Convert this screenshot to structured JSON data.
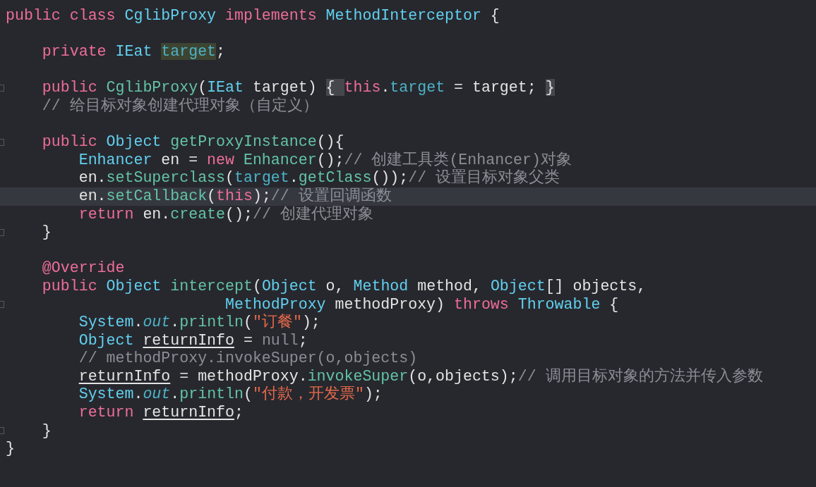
{
  "editor": {
    "lines": [
      {
        "fold_marker": false,
        "current": false,
        "tokens": [
          {
            "text": "public class ",
            "kind": "keyword"
          },
          {
            "text": "CglibProxy ",
            "kind": "type"
          },
          {
            "text": "implements ",
            "kind": "keyword"
          },
          {
            "text": "MethodInterceptor ",
            "kind": "type"
          },
          {
            "text": "{",
            "kind": "plain"
          }
        ]
      },
      {
        "fold_marker": false,
        "current": false
      },
      {
        "fold_marker": false,
        "current": false,
        "tokens": [
          {
            "text": "    private ",
            "kind": "keyword"
          },
          {
            "text": "IEat ",
            "kind": "type"
          },
          {
            "text": "target",
            "kind": "field_highlight"
          },
          {
            "text": ";",
            "kind": "plain"
          }
        ]
      },
      {
        "fold_marker": false,
        "current": false
      },
      {
        "fold_marker": true,
        "current": false,
        "tokens": [
          {
            "text": "    public ",
            "kind": "keyword"
          },
          {
            "text": "CglibProxy",
            "kind": "method"
          },
          {
            "text": "(",
            "kind": "plain"
          },
          {
            "text": "IEat ",
            "kind": "type"
          },
          {
            "text": "target)",
            "kind": "plain"
          },
          {
            "text": " { ",
            "kind": "folded"
          },
          {
            "text": "this",
            "kind": "keyword"
          },
          {
            "text": ".",
            "kind": "plain"
          },
          {
            "text": "target",
            "kind": "field"
          },
          {
            "text": " = target;",
            "kind": "plain"
          },
          {
            "text": " }",
            "kind": "folded"
          }
        ]
      },
      {
        "fold_marker": false,
        "current": false,
        "tokens": [
          {
            "text": "    // 给目标对象创建代理对象（自定义）",
            "kind": "comment"
          }
        ]
      },
      {
        "fold_marker": false,
        "current": false
      },
      {
        "fold_marker": true,
        "current": false,
        "tokens": [
          {
            "text": "    public ",
            "kind": "keyword"
          },
          {
            "text": "Object ",
            "kind": "type"
          },
          {
            "text": "getProxyInstance",
            "kind": "method"
          },
          {
            "text": "(){",
            "kind": "plain"
          }
        ]
      },
      {
        "fold_marker": false,
        "current": false,
        "tokens": [
          {
            "text": "        Enhancer ",
            "kind": "type"
          },
          {
            "text": "en = ",
            "kind": "plain"
          },
          {
            "text": "new ",
            "kind": "keyword"
          },
          {
            "text": "Enhancer",
            "kind": "method"
          },
          {
            "text": "();",
            "kind": "plain"
          },
          {
            "text": "// 创建工具类(Enhancer)对象",
            "kind": "comment"
          }
        ]
      },
      {
        "fold_marker": false,
        "current": false,
        "tokens": [
          {
            "text": "        en.",
            "kind": "plain"
          },
          {
            "text": "setSuperclass",
            "kind": "method"
          },
          {
            "text": "(",
            "kind": "plain"
          },
          {
            "text": "target",
            "kind": "field"
          },
          {
            "text": ".",
            "kind": "plain"
          },
          {
            "text": "getClass",
            "kind": "method"
          },
          {
            "text": "());",
            "kind": "plain"
          },
          {
            "text": "// 设置目标对象父类",
            "kind": "comment"
          }
        ]
      },
      {
        "fold_marker": false,
        "current": true,
        "tokens": [
          {
            "text": "        en.",
            "kind": "plain"
          },
          {
            "text": "setCallback",
            "kind": "method"
          },
          {
            "text": "(",
            "kind": "plain"
          },
          {
            "text": "this",
            "kind": "keyword"
          },
          {
            "text": ");",
            "kind": "plain"
          },
          {
            "text": "// 设置回调函数",
            "kind": "comment"
          }
        ]
      },
      {
        "fold_marker": false,
        "current": false,
        "tokens": [
          {
            "text": "        return ",
            "kind": "keyword"
          },
          {
            "text": "en.",
            "kind": "plain"
          },
          {
            "text": "create",
            "kind": "method"
          },
          {
            "text": "();",
            "kind": "plain"
          },
          {
            "text": "// 创建代理对象",
            "kind": "comment"
          }
        ]
      },
      {
        "fold_marker": true,
        "current": false,
        "tokens": [
          {
            "text": "    }",
            "kind": "plain"
          }
        ]
      },
      {
        "fold_marker": false,
        "current": false
      },
      {
        "fold_marker": false,
        "current": false,
        "tokens": [
          {
            "text": "    @Override",
            "kind": "keyword"
          }
        ]
      },
      {
        "fold_marker": false,
        "current": false,
        "tokens": [
          {
            "text": "    public ",
            "kind": "keyword"
          },
          {
            "text": "Object ",
            "kind": "type"
          },
          {
            "text": "intercept",
            "kind": "method"
          },
          {
            "text": "(",
            "kind": "plain"
          },
          {
            "text": "Object ",
            "kind": "type"
          },
          {
            "text": "o, ",
            "kind": "plain"
          },
          {
            "text": "Method ",
            "kind": "type"
          },
          {
            "text": "method, ",
            "kind": "plain"
          },
          {
            "text": "Object",
            "kind": "type"
          },
          {
            "text": "[] objects,",
            "kind": "plain"
          }
        ]
      },
      {
        "fold_marker": true,
        "current": false,
        "tokens": [
          {
            "text": "                        MethodProxy ",
            "kind": "type"
          },
          {
            "text": "methodProxy) ",
            "kind": "plain"
          },
          {
            "text": "throws ",
            "kind": "keyword"
          },
          {
            "text": "Throwable ",
            "kind": "type"
          },
          {
            "text": "{",
            "kind": "plain"
          }
        ]
      },
      {
        "fold_marker": false,
        "current": false,
        "tokens": [
          {
            "text": "        System",
            "kind": "type"
          },
          {
            "text": ".",
            "kind": "plain"
          },
          {
            "text": "out",
            "kind": "static_field"
          },
          {
            "text": ".",
            "kind": "plain"
          },
          {
            "text": "println",
            "kind": "method"
          },
          {
            "text": "(",
            "kind": "plain"
          },
          {
            "text": "\"订餐\"",
            "kind": "string"
          },
          {
            "text": ");",
            "kind": "plain"
          }
        ]
      },
      {
        "fold_marker": false,
        "current": false,
        "tokens": [
          {
            "text": "        Object ",
            "kind": "type"
          },
          {
            "text": "returnInfo",
            "kind": "reassigned"
          },
          {
            "text": " = ",
            "kind": "plain"
          },
          {
            "text": "null",
            "kind": "literal"
          },
          {
            "text": ";",
            "kind": "plain"
          }
        ]
      },
      {
        "fold_marker": false,
        "current": false,
        "tokens": [
          {
            "text": "        // methodProxy.invokeSuper(o,objects)",
            "kind": "comment"
          }
        ]
      },
      {
        "fold_marker": false,
        "current": false,
        "tokens": [
          {
            "text": "        returnInfo",
            "kind": "reassigned"
          },
          {
            "text": " = methodProxy.",
            "kind": "plain"
          },
          {
            "text": "invokeSuper",
            "kind": "method"
          },
          {
            "text": "(o,objects);",
            "kind": "plain"
          },
          {
            "text": "// 调用目标对象的方法并传入参数",
            "kind": "comment"
          }
        ]
      },
      {
        "fold_marker": false,
        "current": false,
        "tokens": [
          {
            "text": "        System",
            "kind": "type"
          },
          {
            "text": ".",
            "kind": "plain"
          },
          {
            "text": "out",
            "kind": "static_field"
          },
          {
            "text": ".",
            "kind": "plain"
          },
          {
            "text": "println",
            "kind": "method"
          },
          {
            "text": "(",
            "kind": "plain"
          },
          {
            "text": "\"付款，开发票\"",
            "kind": "string"
          },
          {
            "text": ");",
            "kind": "plain"
          }
        ]
      },
      {
        "fold_marker": false,
        "current": false,
        "tokens": [
          {
            "text": "        return ",
            "kind": "keyword"
          },
          {
            "text": "returnInfo",
            "kind": "reassigned"
          },
          {
            "text": ";",
            "kind": "plain"
          }
        ]
      },
      {
        "fold_marker": true,
        "current": false,
        "tokens": [
          {
            "text": "    }",
            "kind": "plain"
          }
        ]
      },
      {
        "fold_marker": false,
        "current": false,
        "tokens": [
          {
            "text": "}",
            "kind": "plain"
          }
        ]
      }
    ]
  }
}
